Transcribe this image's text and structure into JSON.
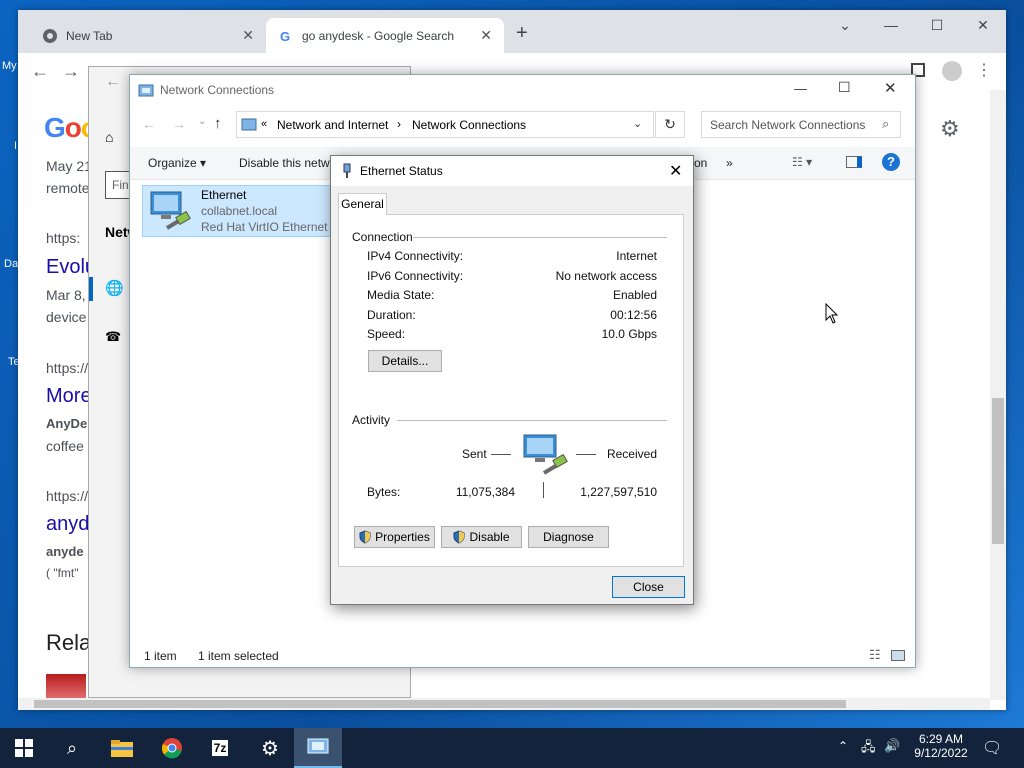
{
  "desktop": {
    "icon_labels": [
      "My",
      "I",
      "Da",
      "Te"
    ]
  },
  "chrome": {
    "tabs": [
      {
        "title": "New Tab"
      },
      {
        "title": "go anydesk - Google Search"
      }
    ],
    "new_tab_glyph": "+",
    "page": {
      "logo_text": "Goo",
      "snippets": [
        "May 21",
        "remote",
        "https:",
        "Evolu",
        "Mar 8,",
        "device",
        "https://",
        "More",
        "AnyDe",
        "coffee",
        "https://",
        "anyd",
        "anyde",
        "( \"fmt\"",
        "Rela"
      ]
    }
  },
  "settings_window": {
    "search_placeholder": "Fin",
    "nav_label": "Netw"
  },
  "network_connections": {
    "title": "Network Connections",
    "breadcrumb": [
      "Network and Internet",
      "Network Connections"
    ],
    "search_placeholder": "Search Network Connections",
    "commands": {
      "organize": "Organize",
      "disable": "Disable this netwo",
      "partial": "on",
      "more": "»"
    },
    "item": {
      "name": "Ethernet",
      "domain": "collabnet.local",
      "adapter": "Red Hat VirtIO Ethernet A"
    },
    "status": {
      "count": "1 item",
      "selected": "1 item selected"
    }
  },
  "ethernet_status": {
    "title": "Ethernet Status",
    "tab": "General",
    "connection": {
      "label": "Connection",
      "rows": [
        {
          "label": "IPv4 Connectivity:",
          "value": "Internet"
        },
        {
          "label": "IPv6 Connectivity:",
          "value": "No network access"
        },
        {
          "label": "Media State:",
          "value": "Enabled"
        },
        {
          "label": "Duration:",
          "value": "00:12:56"
        },
        {
          "label": "Speed:",
          "value": "10.0 Gbps"
        }
      ],
      "details_button": "Details..."
    },
    "activity": {
      "label": "Activity",
      "sent_label": "Sent",
      "received_label": "Received",
      "bytes_label": "Bytes:",
      "bytes_sent": "11,075,384",
      "bytes_received": "1,227,597,510"
    },
    "buttons": {
      "properties": "Properties",
      "disable": "Disable",
      "diagnose": "Diagnose",
      "close": "Close"
    }
  },
  "taskbar": {
    "time": "6:29 AM",
    "date": "9/12/2022",
    "apps": [
      "start-icon",
      "search-icon",
      "file-explorer-icon",
      "chrome-icon",
      "7zip-icon",
      "settings-icon",
      "network-connections-icon"
    ],
    "seven_zip_label": "7z"
  },
  "colors": {
    "taskbar": "#12233b",
    "selection": "#cce8ff",
    "link": "#1a0dab",
    "help_blue": "#1c73d6"
  }
}
